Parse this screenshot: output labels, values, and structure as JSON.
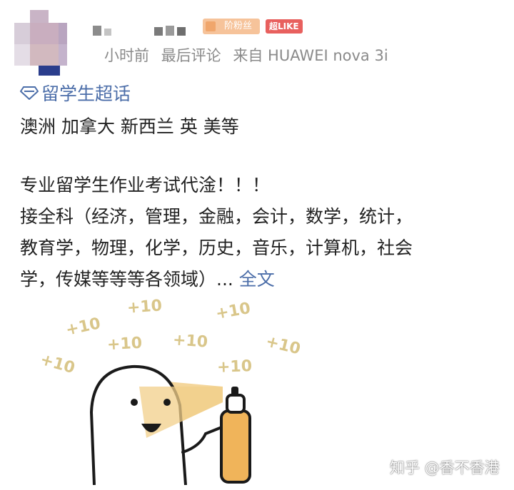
{
  "post": {
    "fan_badge": "阶粉丝",
    "like_badge": "超LIKE",
    "meta": {
      "time": "小时前",
      "comment": "最后评论",
      "source": "来自 HUAWEI nova 3i"
    },
    "topic": "留学生超话",
    "lines": [
      "澳洲 加拿大 新西兰 英 美等",
      "专业留学生作业考试代淦！！！",
      "接全科（经济，管理，金融，会计，数学，统计，",
      "教育学，物理，化学，历史，音乐，计算机，社会",
      "学，传媒等等等各领域）..."
    ],
    "more": "全文"
  },
  "meme": {
    "labels": [
      "+10",
      "+10",
      "+10",
      "+10",
      "+10",
      "+10",
      "+10",
      "+10"
    ]
  },
  "watermark": "知乎 @香不香港",
  "colors": {
    "link": "#4c6ea9",
    "fan_badge": "#f6c39a",
    "like_badge": "#e8605e",
    "spray": "#f2cf8a",
    "bottle": "#f0b45a"
  }
}
